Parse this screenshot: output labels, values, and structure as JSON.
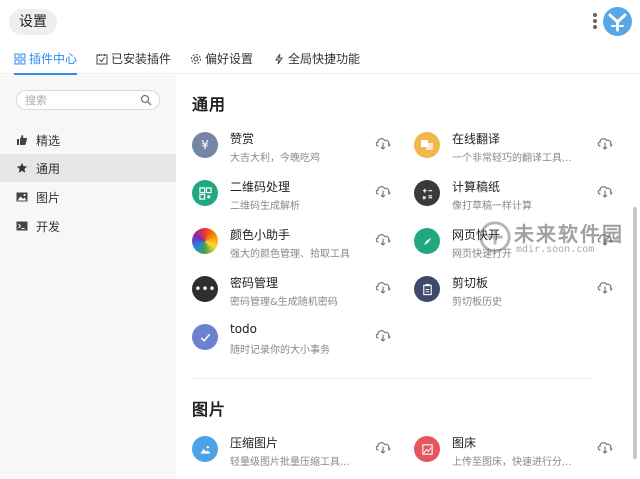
{
  "window": {
    "title": "设置"
  },
  "tabs": [
    {
      "label": "插件中心",
      "icon": "grid-icon",
      "active": true
    },
    {
      "label": "已安装插件",
      "icon": "calendar-check-icon",
      "active": false
    },
    {
      "label": "偏好设置",
      "icon": "gear-icon",
      "active": false
    },
    {
      "label": "全局快捷功能",
      "icon": "lightning-icon",
      "active": false
    }
  ],
  "sidebar": {
    "search_placeholder": "搜索",
    "items": [
      {
        "label": "精选",
        "icon": "thumbs-up-icon",
        "active": false
      },
      {
        "label": "通用",
        "icon": "star-icon",
        "active": true
      },
      {
        "label": "图片",
        "icon": "image-icon",
        "active": false
      },
      {
        "label": "开发",
        "icon": "terminal-icon",
        "active": false
      }
    ]
  },
  "sections": [
    {
      "title": "通用",
      "plugins": [
        {
          "name": "赞赏",
          "desc": "大吉大利，今晚吃鸡",
          "icon": "yen-icon",
          "color": "#7585a6"
        },
        {
          "name": "在线翻译",
          "desc": "一个非常轻巧的翻译工具...",
          "icon": "translate-icon",
          "color": "#f0b84a"
        },
        {
          "name": "二维码处理",
          "desc": "二维码生成解析",
          "icon": "qrcode-icon",
          "color": "#21a883"
        },
        {
          "name": "计算稿纸",
          "desc": "像打草稿一样计算",
          "icon": "calculator-icon",
          "color": "#3a3a3a"
        },
        {
          "name": "颜色小助手",
          "desc": "强大的颜色管理、拾取工具",
          "icon": "color-wheel-icon",
          "color": "#e44"
        },
        {
          "name": "网页快开",
          "desc": "网页快速打开",
          "icon": "compass-icon",
          "color": "#21a883"
        },
        {
          "name": "密码管理",
          "desc": "密码管理&生成随机密码",
          "icon": "password-dots-icon",
          "color": "#2e2e2e"
        },
        {
          "name": "剪切板",
          "desc": "剪切板历史",
          "icon": "clipboard-icon",
          "color": "#3f4a6a"
        },
        {
          "name": "todo",
          "desc": "随时记录你的大小事务",
          "icon": "check-icon",
          "color": "#6c82d0"
        }
      ]
    },
    {
      "title": "图片",
      "plugins": [
        {
          "name": "压缩图片",
          "desc": "轻量级图片批量压缩工具...",
          "icon": "picture-icon",
          "color": "#4aa3e8"
        },
        {
          "name": "图床",
          "desc": "上传至图床，快速进行分...",
          "icon": "picture-frame-icon",
          "color": "#e5575c"
        }
      ]
    }
  ],
  "watermark": {
    "cn": "未来软件园",
    "en": "mdir.soon.com"
  }
}
